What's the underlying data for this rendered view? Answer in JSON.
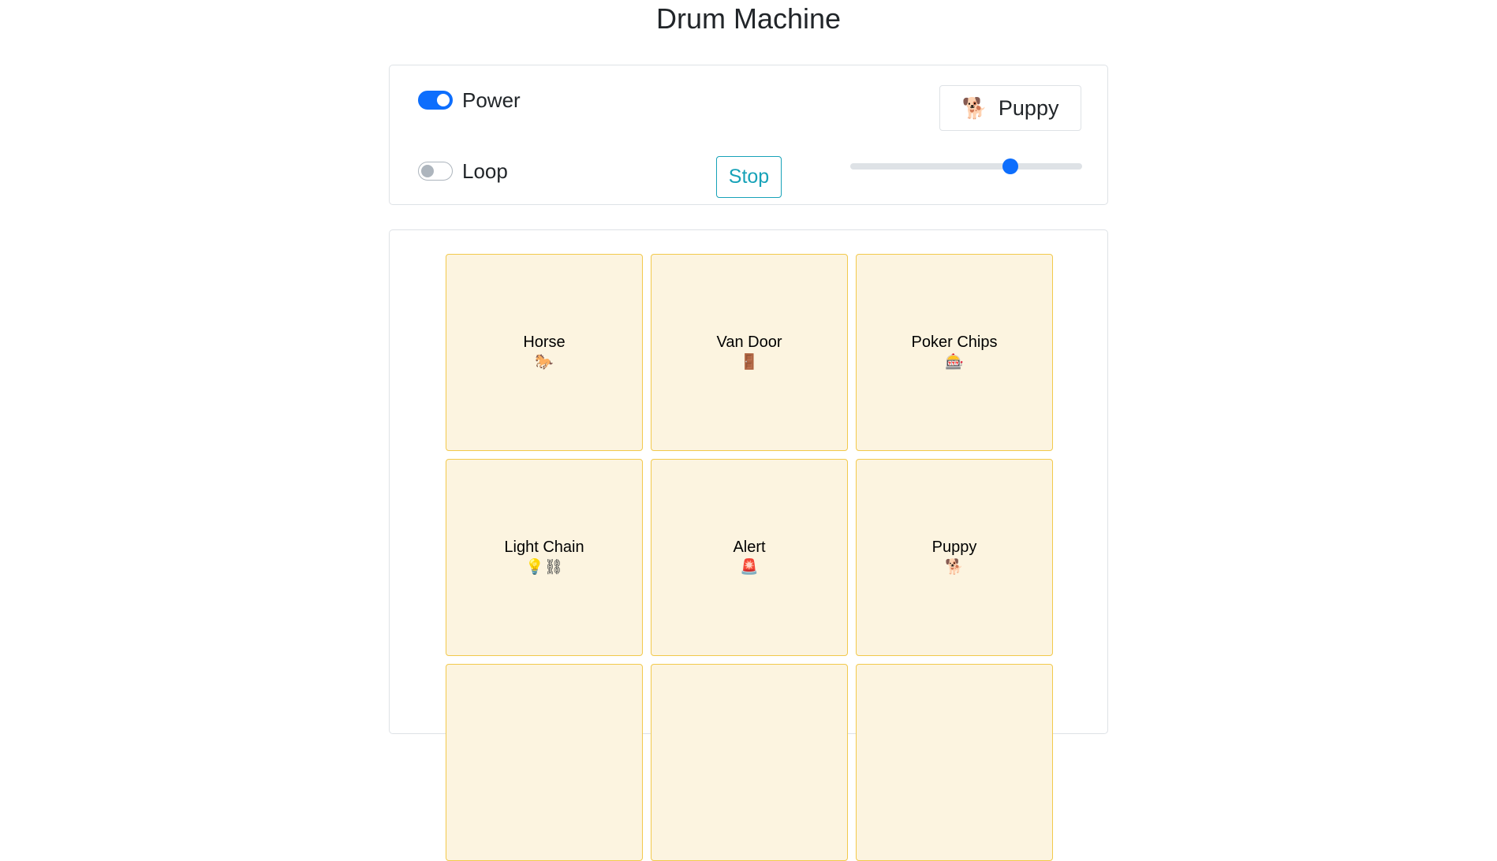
{
  "title": "Drum Machine",
  "controls": {
    "power": {
      "label": "Power",
      "on": true
    },
    "loop": {
      "label": "Loop",
      "on": false
    },
    "stop_label": "Stop",
    "display": {
      "icon": "🐕",
      "icon_name": "dog-icon",
      "text": "Puppy"
    },
    "volume": 0.69
  },
  "colors": {
    "accent": "#0d6efd",
    "stop_button": "#17a2b8",
    "pad_fill": "#fcf4e0",
    "pad_border": "#f2c94c"
  },
  "pads": [
    {
      "label": "Horse",
      "icon": "🐎",
      "icon_name": "horse-icon"
    },
    {
      "label": "Van Door",
      "icon": "🚪",
      "icon_name": "door-icon"
    },
    {
      "label": "Poker Chips",
      "icon": "🎰",
      "icon_name": "slot-machine-icon"
    },
    {
      "label": "Light Chain",
      "icon": "💡⛓",
      "icon_name": "bulb-chain-icon"
    },
    {
      "label": "Alert",
      "icon": "🚨",
      "icon_name": "siren-icon"
    },
    {
      "label": "Puppy",
      "icon": "🐕",
      "icon_name": "dog-icon"
    },
    {
      "label": "",
      "icon": "",
      "icon_name": ""
    },
    {
      "label": "",
      "icon": "",
      "icon_name": ""
    },
    {
      "label": "",
      "icon": "",
      "icon_name": ""
    }
  ]
}
